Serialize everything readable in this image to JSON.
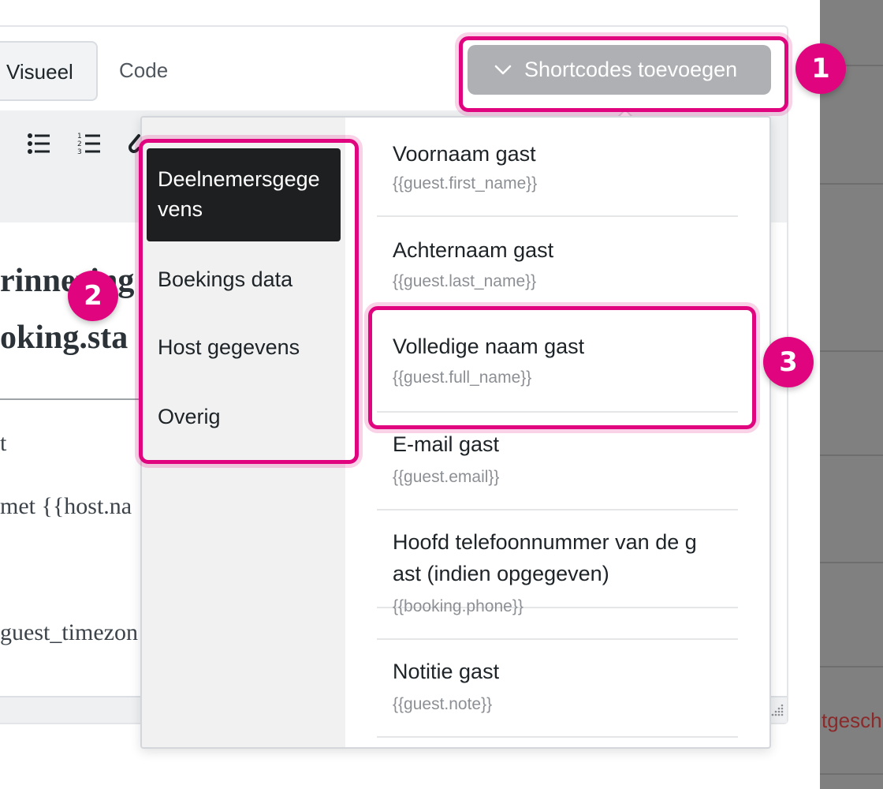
{
  "editor": {
    "tabs": {
      "visual": "Visueel",
      "code": "Code"
    },
    "heading_line1": "rinnering",
    "heading_line2": "oking.sta",
    "body_lines": [
      "t",
      "met {{host.na",
      "guest_timezon"
    ]
  },
  "shortcodes_button": {
    "label": "Shortcodes toevoegen",
    "icon": "chevron-down-icon"
  },
  "dropdown": {
    "categories": [
      {
        "label": "Deelnemersgegevens",
        "line1": "Deelnemersgege",
        "line2": "vens",
        "active": true
      },
      {
        "label": "Boekings data"
      },
      {
        "label": "Host gegevens"
      },
      {
        "label": "Overig"
      }
    ],
    "items": [
      {
        "label": "Voornaam gast",
        "code": "{{guest.first_name}}"
      },
      {
        "label": "Achternaam gast",
        "code": "{{guest.last_name}}"
      },
      {
        "label": "Volledige naam gast",
        "code": "{{guest.full_name}}"
      },
      {
        "label": "E-mail gast",
        "code": "{{guest.email}}"
      },
      {
        "label_line1": "Hoofd telefoonnummer van de g",
        "label_line2": "ast (indien opgegeven)",
        "code": "{{booking.phone}}"
      },
      {
        "label": "Notitie gast",
        "code": "{{guest.note}}"
      }
    ]
  },
  "background_text": "tgesch",
  "annotations": [
    "1",
    "2",
    "3"
  ],
  "colors": {
    "highlight": "#e0057f",
    "active_category": "#1e1f21",
    "button": "#aeb0b4"
  }
}
